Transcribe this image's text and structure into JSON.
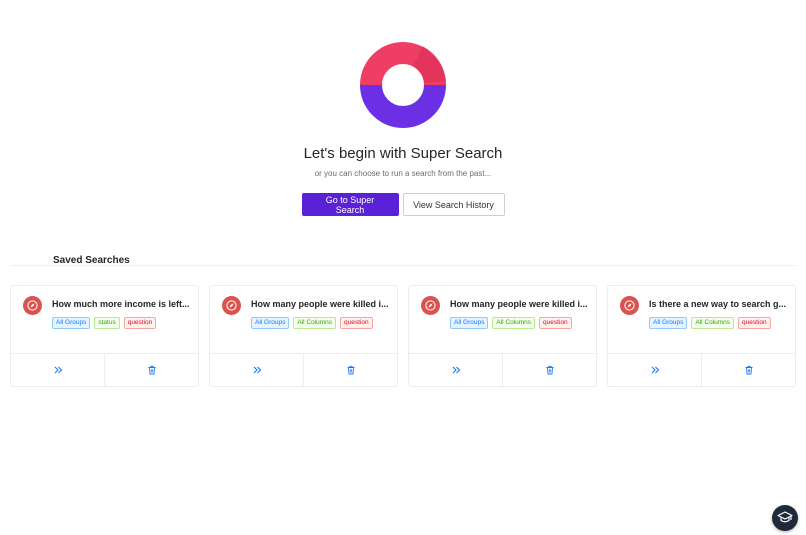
{
  "hero": {
    "logo_icon": "ring-logo-icon",
    "colors": {
      "top": "#ee3e63",
      "bottom": "#6b2fe6"
    },
    "title": "Let's begin with Super Search",
    "subtitle": "or you can choose to run a search from the past...",
    "primary_button": "Go to Super Search",
    "secondary_button": "View Search History"
  },
  "saved_searches": {
    "title": "Saved Searches",
    "cards": [
      {
        "title": "How much more income is left...",
        "tags": [
          {
            "label": "All Groups",
            "color": "blue"
          },
          {
            "label": "status",
            "color": "green"
          },
          {
            "label": "question",
            "color": "red"
          }
        ]
      },
      {
        "title": "How many people were killed i...",
        "tags": [
          {
            "label": "All Groups",
            "color": "blue"
          },
          {
            "label": "All Columns",
            "color": "green"
          },
          {
            "label": "question",
            "color": "red"
          }
        ]
      },
      {
        "title": "How many people were killed i...",
        "tags": [
          {
            "label": "All Groups",
            "color": "blue"
          },
          {
            "label": "All Columns",
            "color": "green"
          },
          {
            "label": "question",
            "color": "red"
          }
        ]
      },
      {
        "title": "Is there a new way to search g...",
        "tags": [
          {
            "label": "All Groups",
            "color": "blue"
          },
          {
            "label": "All Columns",
            "color": "green"
          },
          {
            "label": "question",
            "color": "red"
          }
        ]
      }
    ],
    "card_icon": "compass-icon",
    "run_icon": "double-chevron-right-icon",
    "delete_icon": "trash-icon"
  },
  "help": {
    "icon": "graduation-cap-icon"
  }
}
